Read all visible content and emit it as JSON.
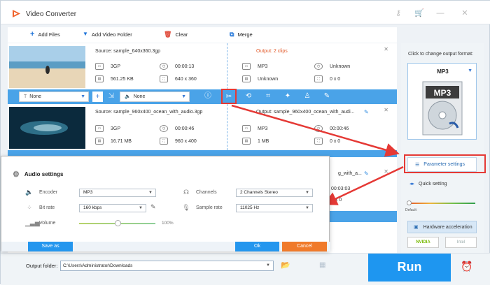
{
  "app": {
    "title": "Video Converter"
  },
  "toolbar": {
    "add_files": "Add Files",
    "add_video_folder": "Add Video Folder",
    "clear": "Clear",
    "merge": "Merge"
  },
  "items": [
    {
      "source": "Source: sample_640x360.3gp",
      "format": "3GP",
      "duration": "00:00:13",
      "size": "561.25 KB",
      "resolution": "640 x 360",
      "output_label": "Output: 2 clips",
      "out_format": "MP3",
      "out_duration": "Unknown",
      "out_size": "Unknown",
      "out_resolution": "0 x 0"
    },
    {
      "source": "Source: sample_960x400_ocean_with_audio.3gp",
      "format": "3GP",
      "duration": "00:00:46",
      "size": "16.71 MB",
      "resolution": "960 x 400",
      "output_label": "Output: sample_960x400_ocean_with_audi...",
      "out_format": "MP3",
      "out_duration": "00:00:46",
      "out_size": "1 MB",
      "out_resolution": "0 x 0"
    }
  ],
  "partial_item": {
    "output_label": "g_with_a...",
    "out_duration": "00:03:03",
    "out_resolution": "0 x 0"
  },
  "editbar": {
    "subtitle": "None",
    "audio": "None"
  },
  "side": {
    "hint": "Click to change output format:",
    "format": "MP3",
    "param_settings": "Parameter settings",
    "quick_setting": "Quick setting",
    "default_label": "Default",
    "hw_accel": "Hardware acceleration",
    "gpu1": "NVIDIA",
    "gpu2": "Intel"
  },
  "dialog": {
    "title": "Audio settings",
    "encoder_label": "Encoder",
    "encoder": "MP3",
    "channels_label": "Channels",
    "channels": "2 Channels Stereo",
    "bitrate_label": "Bit rate",
    "bitrate": "160 kbps",
    "samplerate_label": "Sample rate",
    "samplerate": "11025 Hz",
    "volume_label": "Volume",
    "volume_pct": "100%",
    "volume_level": 0.5,
    "save_as": "Save as",
    "ok": "Ok",
    "cancel": "Cancel"
  },
  "bottom": {
    "output_folder_label": "Output folder:",
    "path": "C:\\Users\\Administrator\\Downloads",
    "run": "Run"
  },
  "colors": {
    "accent": "#1e96f0",
    "highlight": "#e53935",
    "cancel": "#f07a2a"
  }
}
